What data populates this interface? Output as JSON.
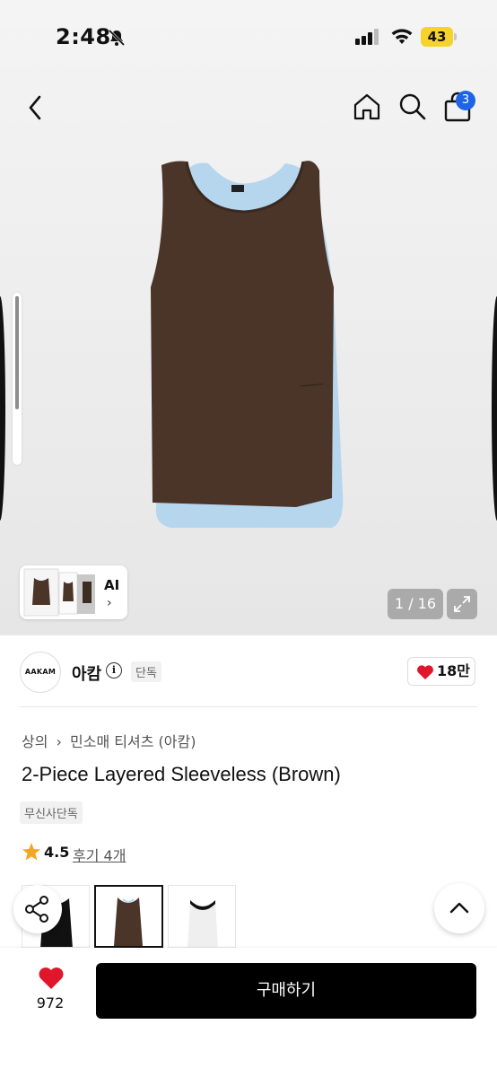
{
  "status_bar": {
    "time": "2:48",
    "battery": "43"
  },
  "header": {
    "cart_count": "3"
  },
  "gallery": {
    "counter": "1 / 16",
    "ai_label": "AI",
    "ai_chevron": "›"
  },
  "brand": {
    "logo_text": "AAKAM",
    "name": "아캄",
    "info_glyph": "i",
    "exclusive_badge": "단독",
    "likes": "18만"
  },
  "product": {
    "breadcrumb": [
      "상의",
      "›",
      "민소매 티셔츠 (아캄)"
    ],
    "title": "2-Piece Layered Sleeveless (Brown)",
    "tag": "무신사단독",
    "rating": "4.5",
    "reviews": "후기 4개"
  },
  "colors": {
    "accent_badge": "#1e64e6",
    "like_heart": "#e0162b",
    "rating_star": "#f5a623",
    "product_brown": "#4a3528",
    "product_blue": "#b6d6ee"
  },
  "bottom": {
    "like_count": "972",
    "buy_label": "구매하기"
  }
}
